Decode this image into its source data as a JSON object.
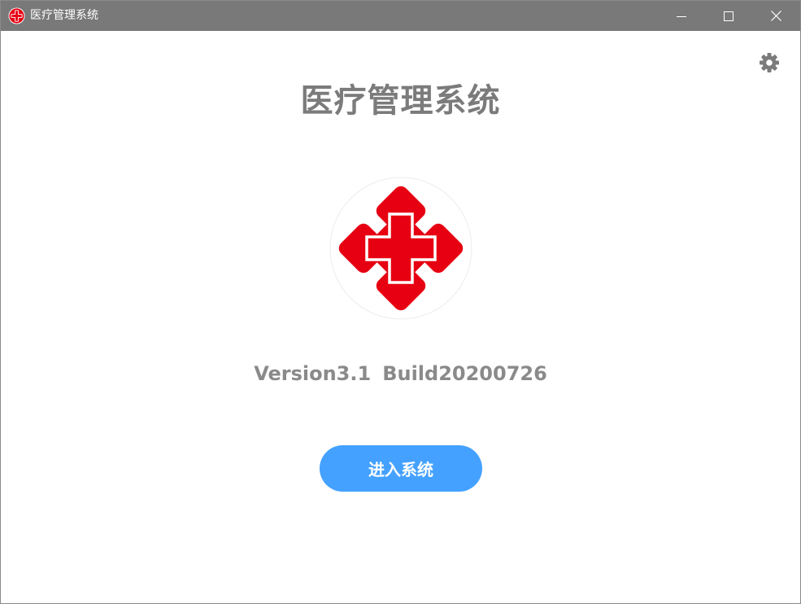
{
  "window": {
    "title": "医疗管理系统",
    "controls": {
      "minimize": "minimize-icon",
      "maximize": "maximize-icon",
      "close": "close-icon"
    }
  },
  "header": {
    "settings_icon": "gear-icon"
  },
  "main": {
    "title": "医疗管理系统",
    "logo_icon": "red-cross-icon",
    "version": "Version3.1",
    "build": "Build20200726",
    "enter_button_label": "进入系统"
  },
  "colors": {
    "titlebar": "#797979",
    "accent_button": "#44a1ff",
    "logo_red": "#e60012",
    "title_text": "#7b7b7b",
    "version_text": "#8a8a8a"
  }
}
